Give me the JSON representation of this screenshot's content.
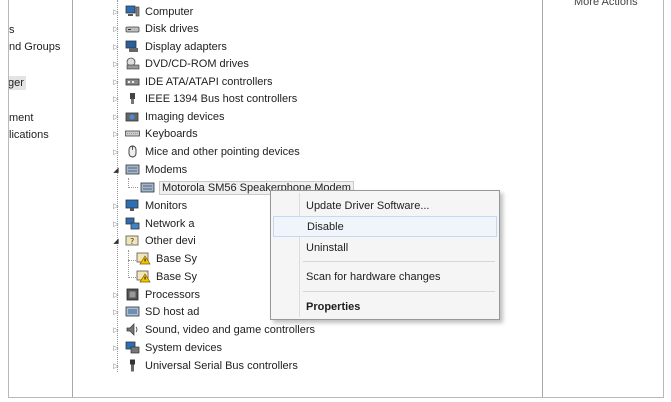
{
  "left_pane": {
    "items": [
      {
        "label": "s"
      },
      {
        "label": "nd Groups"
      },
      {
        "label": "ger"
      },
      {
        "label": "ment"
      },
      {
        "label": "lications"
      }
    ]
  },
  "actions_pane": {
    "title": "More Actions"
  },
  "tree": {
    "nodes": [
      {
        "label": "Computer",
        "icon": "computer-icon"
      },
      {
        "label": "Disk drives",
        "icon": "disk-drive-icon"
      },
      {
        "label": "Display adapters",
        "icon": "display-adapter-icon"
      },
      {
        "label": "DVD/CD-ROM drives",
        "icon": "dvd-drive-icon"
      },
      {
        "label": "IDE ATA/ATAPI controllers",
        "icon": "ide-controller-icon"
      },
      {
        "label": "IEEE 1394 Bus host controllers",
        "icon": "ieee1394-icon"
      },
      {
        "label": "Imaging devices",
        "icon": "camera-icon"
      },
      {
        "label": "Keyboards",
        "icon": "keyboard-icon"
      },
      {
        "label": "Mice and other pointing devices",
        "icon": "mouse-icon"
      },
      {
        "label": "Modems",
        "icon": "modem-icon"
      },
      {
        "label": "Motorola SM56 Speakerphone Modem",
        "icon": "modem-icon"
      },
      {
        "label": "Monitors",
        "icon": "monitor-icon"
      },
      {
        "label": "Network a",
        "icon": "network-icon"
      },
      {
        "label": "Other devi",
        "icon": "unknown-device-icon"
      },
      {
        "label": "Base Sy",
        "icon": "warning-device-icon"
      },
      {
        "label": "Base Sy",
        "icon": "warning-device-icon"
      },
      {
        "label": "Processors",
        "icon": "processor-icon"
      },
      {
        "label": "SD host ad",
        "icon": "sd-host-icon"
      },
      {
        "label": "Sound, video and game controllers",
        "icon": "speaker-icon"
      },
      {
        "label": "System devices",
        "icon": "system-device-icon"
      },
      {
        "label": "Universal Serial Bus controllers",
        "icon": "usb-icon"
      }
    ]
  },
  "context_menu": {
    "items": [
      {
        "label": "Update Driver Software..."
      },
      {
        "label": "Disable"
      },
      {
        "label": "Uninstall"
      },
      {
        "label": "Scan for hardware changes"
      },
      {
        "label": "Properties"
      }
    ]
  }
}
